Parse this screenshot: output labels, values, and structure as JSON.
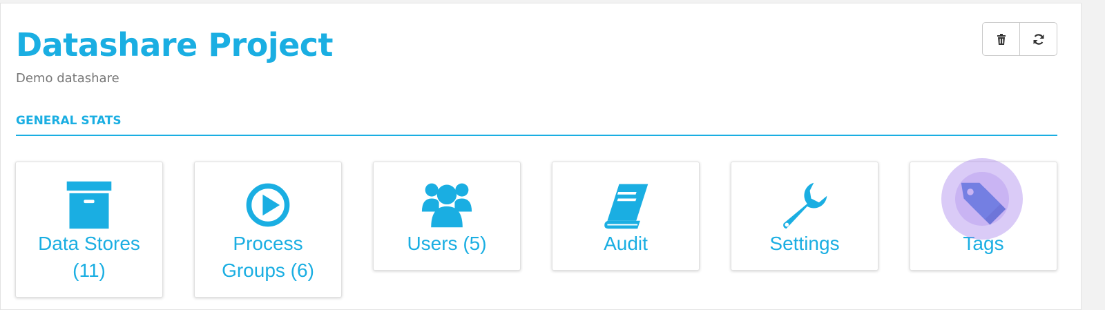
{
  "header": {
    "title": "Datashare Project",
    "subtitle": "Demo datashare"
  },
  "toolbar": {
    "delete_icon": "trash-icon",
    "refresh_icon": "refresh-icon"
  },
  "section": {
    "label": "GENERAL STATS"
  },
  "tiles": [
    {
      "label": "Data Stores (11)",
      "icon": "archive-box-icon"
    },
    {
      "label": "Process Groups (6)",
      "icon": "play-circle-icon"
    },
    {
      "label": "Users (5)",
      "icon": "users-icon"
    },
    {
      "label": "Audit",
      "icon": "book-icon"
    },
    {
      "label": "Settings",
      "icon": "wrench-icon"
    },
    {
      "label": "Tags",
      "icon": "tags-icon"
    }
  ],
  "colors": {
    "accent": "#1aaee2",
    "tags_icon": "#3b86d8",
    "click_highlight": "#a882eb",
    "subtitle": "#777777"
  }
}
